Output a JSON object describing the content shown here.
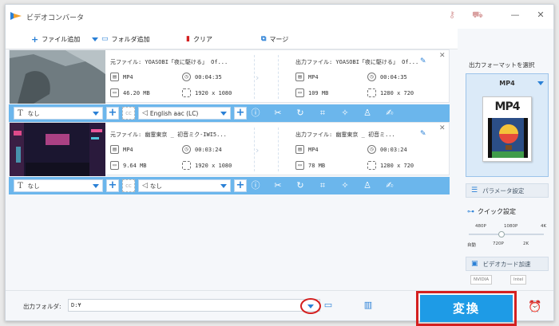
{
  "window": {
    "title": "ビデオコンバータ"
  },
  "toolbar": {
    "add_file": "ファイル追加",
    "add_folder": "フォルダ追加",
    "clear": "クリア",
    "merge": "マージ"
  },
  "items": [
    {
      "source_file": "元ファイル: YOASOBI「夜に駆ける」 Of...",
      "source_format": "MP4",
      "source_duration": "00:04:35",
      "source_size": "46.20 MB",
      "source_resolution": "1920 x 1080",
      "output_file": "出力ファイル: YOASOBI「夜に駆ける」 Of...",
      "output_format": "MP4",
      "output_duration": "00:04:35",
      "output_size": "109 MB",
      "output_resolution": "1280 x 720",
      "subtitle": "なし",
      "audio": "English aac (LC)"
    },
    {
      "source_file": "元ファイル: 幽霊東京 _ 初音ミク-IWI5...",
      "source_format": "MP4",
      "source_duration": "00:03:24",
      "source_size": "9.64 MB",
      "source_resolution": "1920 x 1080",
      "output_file": "出力ファイル: 幽霊東京 _ 初音ミ...",
      "output_format": "MP4",
      "output_duration": "00:03:24",
      "output_size": "78 MB",
      "output_resolution": "1280 x 720",
      "subtitle": "なし",
      "audio": "なし"
    }
  ],
  "right_panel": {
    "select_format": "出力フォーマットを選択",
    "format": "MP4",
    "format_icon_text": "MP4",
    "parameter_settings": "パラメータ設定",
    "quick_settings": "クイック設定",
    "quality_top": [
      "480P",
      "1080P",
      "4K"
    ],
    "quality_bottom": [
      "自動",
      "720P",
      "2K"
    ],
    "quality_selected": "720P",
    "gpu_acceleration": "ビデオカード加速",
    "gpu_vendors": [
      "NVIDIA",
      "Intel"
    ]
  },
  "bottom": {
    "output_folder_label": "出力フォルダ:",
    "output_folder_value": "D:¥",
    "convert": "変換"
  },
  "colors": {
    "accent": "#1e9be6",
    "bar": "#6bb6ec",
    "highlight": "#d42020"
  }
}
